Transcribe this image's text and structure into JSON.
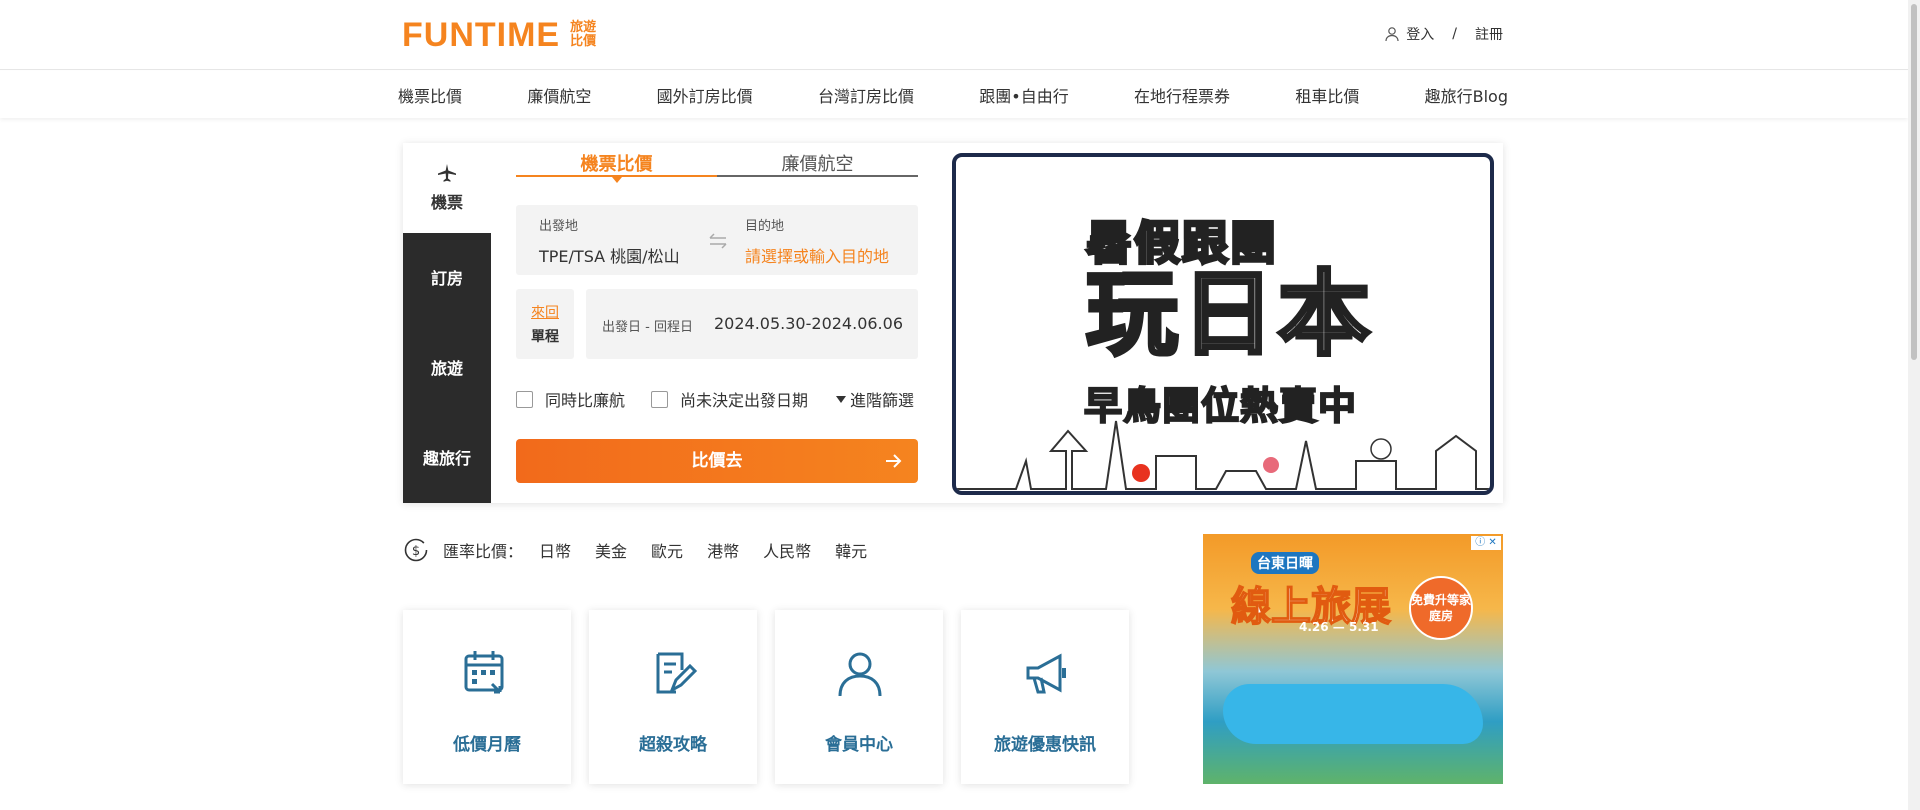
{
  "header": {
    "logo": "FUNTIME",
    "logo_sub": "旅遊比價",
    "login": "登入",
    "separator": "/",
    "register": "註冊"
  },
  "nav": [
    "機票比價",
    "廉價航空",
    "國外訂房比價",
    "台灣訂房比價",
    "跟團•自由行",
    "在地行程票券",
    "租車比價",
    "趣旅行Blog"
  ],
  "sidebar": [
    {
      "label": "機票",
      "icon": "airplane-icon",
      "active": true
    },
    {
      "label": "訂房"
    },
    {
      "label": "旅遊"
    },
    {
      "label": "趣旅行"
    }
  ],
  "search": {
    "tabs": [
      "機票比價",
      "廉價航空"
    ],
    "origin_label": "出發地",
    "origin_value": "TPE/TSA 桃園/松山",
    "destination_label": "目的地",
    "destination_placeholder": "請選擇或輸入目的地",
    "trip_roundtrip": "來回",
    "trip_oneway": "單程",
    "dates_label": "出發日 - 回程日",
    "dates_value": "2024.05.30-2024.06.06",
    "option_lcc": "同時比廉航",
    "option_undecided": "尚未決定出發日期",
    "option_advanced": "進階篩選",
    "submit": "比價去"
  },
  "banner": {
    "line1": "暑假跟團",
    "line2": "玩日本",
    "line3": "早鳥團位熱賣中"
  },
  "exchange": {
    "label": "匯率比價：",
    "currencies": [
      "日幣",
      "美金",
      "歐元",
      "港幣",
      "人民幣",
      "韓元"
    ]
  },
  "tiles": [
    {
      "label": "低價月曆",
      "icon": "calendar-icon"
    },
    {
      "label": "超殺攻略",
      "icon": "edit-note-icon"
    },
    {
      "label": "會員中心",
      "icon": "user-icon"
    },
    {
      "label": "旅遊優惠快訊",
      "icon": "megaphone-icon"
    }
  ],
  "ad": {
    "tag": "台東日暉",
    "title": "線上旅展",
    "dates": "4.26 — 5.31",
    "badge": "免費升等家庭房",
    "close": "ⓘ ✕"
  },
  "colors": {
    "brand": "#f5841f",
    "sidebar": "#2b2b2b",
    "tile_text": "#2a6e96"
  }
}
